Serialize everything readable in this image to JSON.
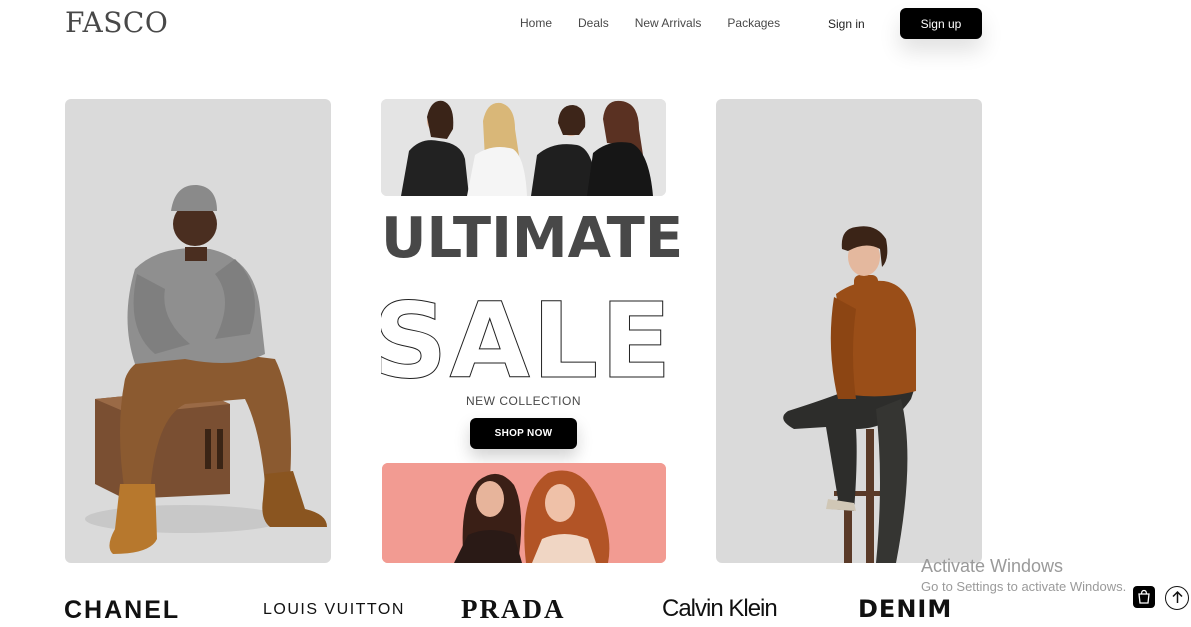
{
  "header": {
    "logo": "FASCO",
    "nav": [
      "Home",
      "Deals",
      "New Arrivals",
      "Packages"
    ],
    "signin": "Sign in",
    "signup": "Sign up"
  },
  "hero": {
    "headline": "ULTIMATE",
    "sale": "SALE",
    "subtitle": "NEW COLLECTION",
    "cta": "SHOP NOW"
  },
  "brands": [
    "CHANEL",
    "LOUIS VUITTON",
    "PRADA",
    "Calvin Klein",
    "DENIM"
  ],
  "overlay": {
    "title": "Activate Windows",
    "subtitle": "Go to Settings to activate Windows."
  },
  "icons": {
    "cart": "shopping-bag-icon",
    "scroll_top": "arrow-up-icon"
  },
  "colors": {
    "panel": "#dadada",
    "coral": "#f29b92",
    "button": "#000000"
  }
}
